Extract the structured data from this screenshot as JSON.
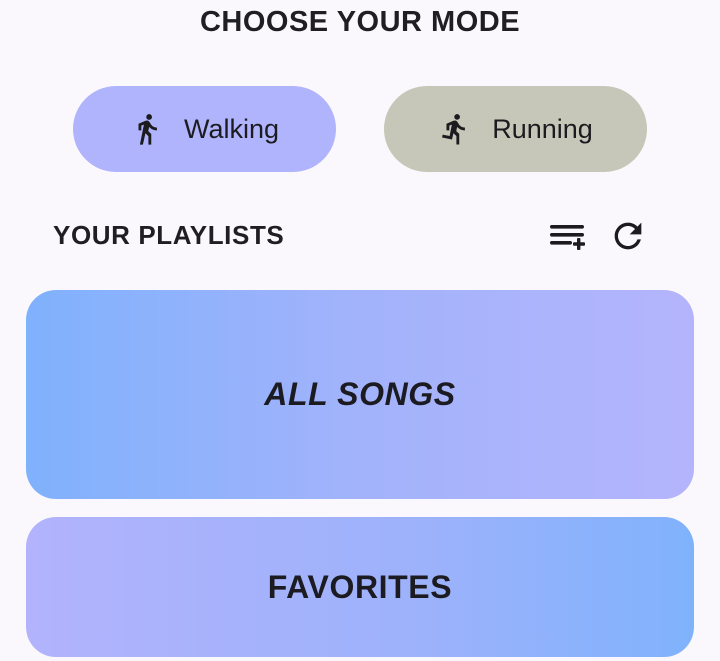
{
  "header": {
    "title": "CHOOSE YOUR MODE"
  },
  "modes": {
    "walking": {
      "label": "Walking",
      "icon": "walking-icon",
      "color": "#b0b4fc"
    },
    "running": {
      "label": "Running",
      "icon": "running-icon",
      "color": "#c6c7b8"
    }
  },
  "playlists": {
    "header": "YOUR PLAYLISTS",
    "actions": {
      "queue_icon": "playlist-add-icon",
      "refresh_icon": "refresh-icon"
    },
    "items": [
      {
        "label": "ALL SONGS"
      },
      {
        "label": "FAVORITES"
      }
    ]
  }
}
